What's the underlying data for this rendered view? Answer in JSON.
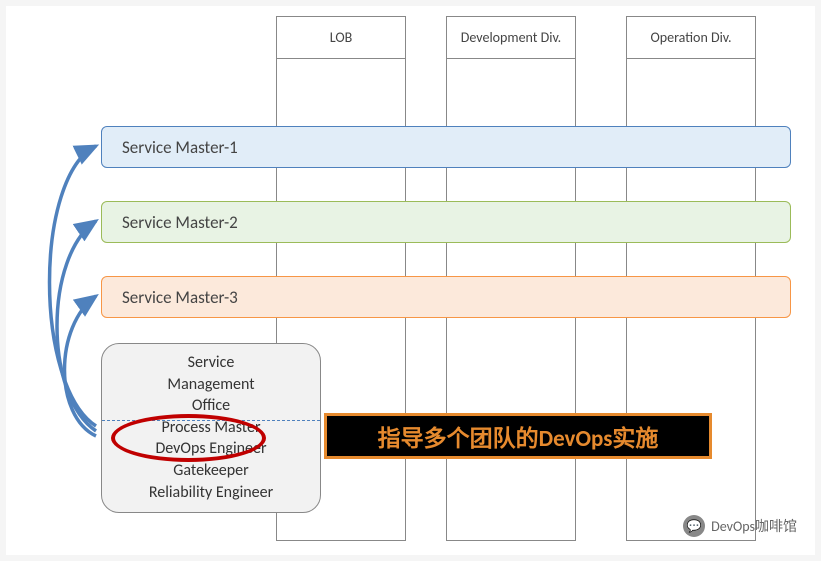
{
  "columns": {
    "lob": "LOB",
    "dev": "Development Div.",
    "ops": "Operation Div."
  },
  "services": {
    "sm1": "Service Master-1",
    "sm2": "Service Master-2",
    "sm3": "Service Master-3"
  },
  "smo": {
    "line1": "Service",
    "line2": "Management",
    "line3": "Office",
    "line4": "Process Master",
    "line5": "DevOps Engineer",
    "line6": "Gatekeeper",
    "line7": "Reliability Engineer"
  },
  "callout": "指导多个团队的DevOps实施",
  "watermark": "DevOps咖啡馆",
  "wm_icon": "💬"
}
